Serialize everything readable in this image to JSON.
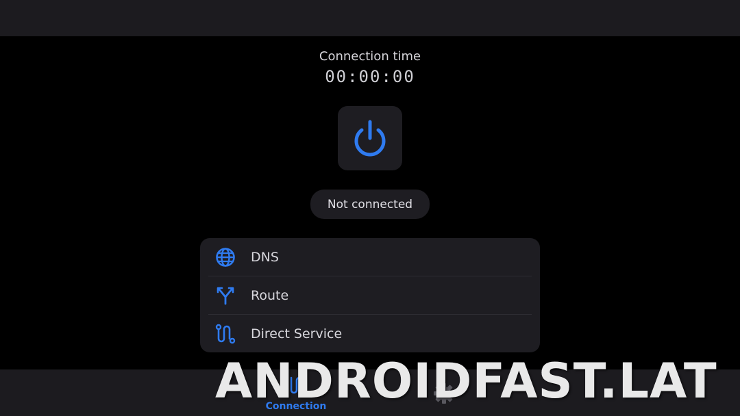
{
  "connection": {
    "time_label": "Connection time",
    "timer": "00:00:00",
    "status": "Not connected",
    "power_icon": "power-icon"
  },
  "options": [
    {
      "label": "DNS",
      "icon": "globe-icon"
    },
    {
      "label": "Route",
      "icon": "route-split-icon"
    },
    {
      "label": "Direct Service",
      "icon": "path-icon"
    }
  ],
  "bottom_nav": {
    "items": [
      {
        "label": "Connection",
        "icon": "path-icon",
        "active": true
      },
      {
        "label": "",
        "icon": "gear-icon",
        "active": false
      }
    ]
  },
  "watermark": "ANDROIDFAST.LAT",
  "colors": {
    "accent": "#2f7bf0",
    "background": "#000000",
    "surface": "#1e1d22"
  }
}
